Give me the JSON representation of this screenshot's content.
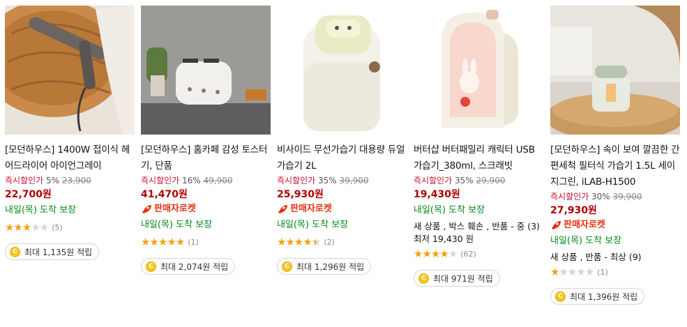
{
  "products": [
    {
      "title": "[모던하우스] 1400W 접이식 헤어드라이어 아이언그레이",
      "instant_label": "즉시할인가",
      "discount": "5%",
      "old_price": "23,900",
      "price": "22,700",
      "won": "원",
      "rocket": "",
      "delivery": "내일(목) 도착 보장",
      "extra": "",
      "rating": 3,
      "review_count": "(5)",
      "points": "최대 1,135원 적립"
    },
    {
      "title": "[모던하우스] 홈카페 감성 토스터기, 단품",
      "instant_label": "즉시할인가",
      "discount": "16%",
      "old_price": "49,900",
      "price": "41,470",
      "won": "원",
      "rocket": "판매자로켓",
      "delivery": "내일(목) 도착 보장",
      "extra": "",
      "rating": 5,
      "review_count": "(1)",
      "points": "최대 2,074원 적립"
    },
    {
      "title": "비사이드 무선가습기 대용량 듀얼 가습기 2L",
      "instant_label": "즉시할인가",
      "discount": "35%",
      "old_price": "39,900",
      "price": "25,930",
      "won": "원",
      "rocket": "판매자로켓",
      "delivery": "내일(목) 도착 보장",
      "extra": "",
      "rating": 4.5,
      "review_count": "(2)",
      "points": "최대 1,296원 적립"
    },
    {
      "title": "버터샵 버터패밀리 캐릭터 USB 가습기_380ml, 스크래빗",
      "instant_label": "즉시할인가",
      "discount": "35%",
      "old_price": "29,900",
      "price": "19,430",
      "won": "원",
      "rocket": "",
      "delivery": "내일(목) 도착 보장",
      "extra": "새 상품 , 박스 훼손 , 반품 - 중 (3) 최저 19,430 원",
      "rating": 4,
      "review_count": "(62)",
      "points": "최대 971원 적립"
    },
    {
      "title": "[모던하우스] 속이 보여 깔끔한 간편세척 필터식 가습기 1.5L 세이지그린, iLAB-H1500",
      "instant_label": "즉시할인가",
      "discount": "30%",
      "old_price": "39,900",
      "price": "27,930",
      "won": "원",
      "rocket": "판매자로켓",
      "delivery": "내일(목) 도착 보장",
      "extra": "새 상품 , 반품 - 최상 (9)",
      "rating": 1,
      "review_count": "(1)",
      "points": "최대 1,396원 적립"
    }
  ],
  "colors": {
    "price": "#ae0000",
    "delivery": "#00891a",
    "rocket": "#e5320f",
    "star": "#f2a20f"
  },
  "icons": {
    "coin": "coin-icon",
    "rocket": "rocket-icon",
    "star": "star-icon"
  }
}
